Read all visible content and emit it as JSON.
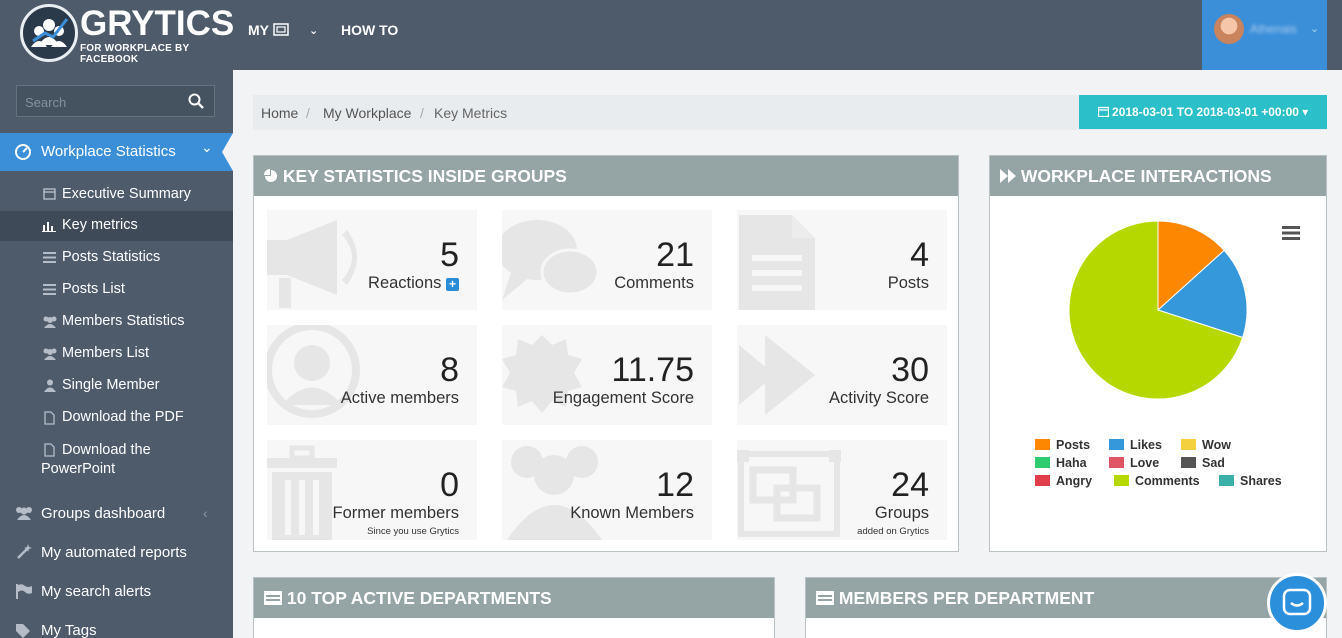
{
  "app": {
    "brand": "GRYTICS",
    "brand_sub": "FOR WORKPLACE BY FACEBOOK"
  },
  "nav": {
    "my_label": "MY",
    "howto_label": "HOW TO",
    "user_name": "Athenais"
  },
  "sidebar": {
    "search_placeholder": "Search",
    "section": "Workplace Statistics",
    "subitems": [
      {
        "label": "Executive Summary",
        "icon": "calendar-icon"
      },
      {
        "label": "Key metrics",
        "icon": "bar-chart-icon"
      },
      {
        "label": "Posts Statistics",
        "icon": "list-icon"
      },
      {
        "label": "Posts List",
        "icon": "list-icon"
      },
      {
        "label": "Members Statistics",
        "icon": "users-icon"
      },
      {
        "label": "Members List",
        "icon": "users-icon"
      },
      {
        "label": "Single Member",
        "icon": "user-icon"
      },
      {
        "label": "Download the PDF",
        "icon": "pdf-file-icon"
      },
      {
        "label": "Download the PowerPoint",
        "icon": "ppt-file-icon"
      }
    ],
    "items": [
      {
        "label": "Groups dashboard",
        "icon": "groups-icon"
      },
      {
        "label": "My automated reports",
        "icon": "wand-icon"
      },
      {
        "label": "My search alerts",
        "icon": "flag-icon"
      },
      {
        "label": "My Tags",
        "icon": "tags-icon"
      }
    ]
  },
  "breadcrumb": [
    "Home",
    "My Workplace",
    "Key Metrics"
  ],
  "date_range": "2018-03-01 TO 2018-03-01 +00:00",
  "key_stats": {
    "title": "KEY STATISTICS INSIDE GROUPS",
    "tiles": [
      {
        "value": "5",
        "label": "Reactions",
        "note": "",
        "icon": "megaphone-icon"
      },
      {
        "value": "21",
        "label": "Comments",
        "note": "",
        "icon": "comments-icon"
      },
      {
        "value": "4",
        "label": "Posts",
        "note": "",
        "icon": "document-icon"
      },
      {
        "value": "8",
        "label": "Active members",
        "note": "",
        "icon": "user-circle-icon"
      },
      {
        "value": "11.75",
        "label": "Engagement Score",
        "note": "",
        "icon": "badge-icon"
      },
      {
        "value": "30",
        "label": "Activity Score",
        "note": "",
        "icon": "fast-forward-icon"
      },
      {
        "value": "0",
        "label": "Former members",
        "note": "Since you use Grytics",
        "icon": "trash-icon"
      },
      {
        "value": "12",
        "label": "Known Members",
        "note": "",
        "icon": "users-icon"
      },
      {
        "value": "24",
        "label": "Groups",
        "note": "added on Grytics",
        "icon": "object-group-icon"
      }
    ]
  },
  "interactions": {
    "title": "WORKPLACE INTERACTIONS",
    "legend": [
      {
        "name": "Posts",
        "color": "#fd8700"
      },
      {
        "name": "Likes",
        "color": "#3498db"
      },
      {
        "name": "Wow",
        "color": "#f4d03f"
      },
      {
        "name": "Haha",
        "color": "#2ecc71"
      },
      {
        "name": "Love",
        "color": "#e05563"
      },
      {
        "name": "Sad",
        "color": "#555555"
      },
      {
        "name": "Angry",
        "color": "#e03e4a"
      },
      {
        "name": "Comments",
        "color": "#b5d900"
      },
      {
        "name": "Shares",
        "color": "#3ab0a8"
      }
    ]
  },
  "chart_data": {
    "type": "pie",
    "categories": [
      "Posts",
      "Likes",
      "Wow",
      "Haha",
      "Love",
      "Sad",
      "Angry",
      "Comments",
      "Shares"
    ],
    "values": [
      4,
      5,
      0,
      0,
      0,
      0,
      0,
      21,
      0
    ],
    "colors": [
      "#fd8700",
      "#3498db",
      "#f4d03f",
      "#2ecc71",
      "#e05563",
      "#555555",
      "#e03e4a",
      "#b5d900",
      "#3ab0a8"
    ],
    "legend": "bottom"
  },
  "panels": {
    "departments": "10 TOP ACTIVE DEPARTMENTS",
    "members_per_department": "MEMBERS PER DEPARTMENT"
  }
}
